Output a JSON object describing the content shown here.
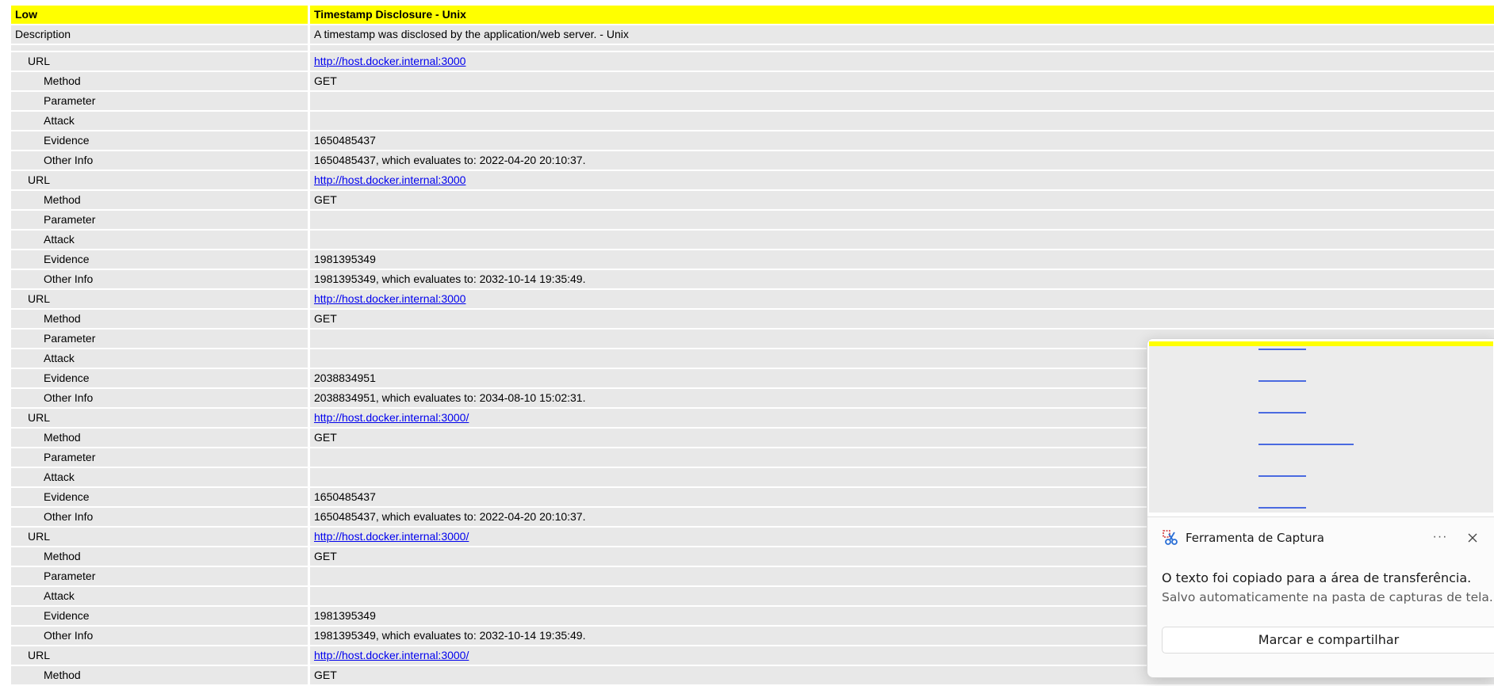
{
  "header": {
    "risk": "Low",
    "title": "Timestamp Disclosure - Unix"
  },
  "description": {
    "label": "Description",
    "value": "A timestamp was disclosed by the application/web server. - Unix"
  },
  "labels": {
    "url": "URL",
    "method": "Method",
    "parameter": "Parameter",
    "attack": "Attack",
    "evidence": "Evidence",
    "other_info": "Other Info"
  },
  "instances": [
    {
      "url": "http://host.docker.internal:3000",
      "method": "GET",
      "parameter": "",
      "attack": "",
      "evidence": "1650485437",
      "other_info": "1650485437, which evaluates to: 2022-04-20 20:10:37."
    },
    {
      "url": "http://host.docker.internal:3000",
      "method": "GET",
      "parameter": "",
      "attack": "",
      "evidence": "1981395349",
      "other_info": "1981395349, which evaluates to: 2032-10-14 19:35:49."
    },
    {
      "url": "http://host.docker.internal:3000",
      "method": "GET",
      "parameter": "",
      "attack": "",
      "evidence": "2038834951",
      "other_info": "2038834951, which evaluates to: 2034-08-10 15:02:31."
    },
    {
      "url": "http://host.docker.internal:3000/",
      "method": "GET",
      "parameter": "",
      "attack": "",
      "evidence": "1650485437",
      "other_info": "1650485437, which evaluates to: 2022-04-20 20:10:37."
    },
    {
      "url": "http://host.docker.internal:3000/",
      "method": "GET",
      "parameter": "",
      "attack": "",
      "evidence": "1981395349",
      "other_info": "1981395349, which evaluates to: 2032-10-14 19:35:49."
    },
    {
      "url": "http://host.docker.internal:3000/",
      "method": "GET"
    }
  ],
  "notification": {
    "app_name": "Ferramenta de Captura",
    "more_label": "···",
    "message": "O texto foi copiado para a área de transferência.",
    "submessage": "Salvo automaticamente na pasta de capturas de tela.",
    "action_label": "Marcar e compartilhar",
    "icon": "snipping-tool-icon",
    "close_icon": "close-icon"
  },
  "colors": {
    "header_bg": "#ffff00",
    "row_bg": "#e8e8e8",
    "link": "#0000ee"
  }
}
